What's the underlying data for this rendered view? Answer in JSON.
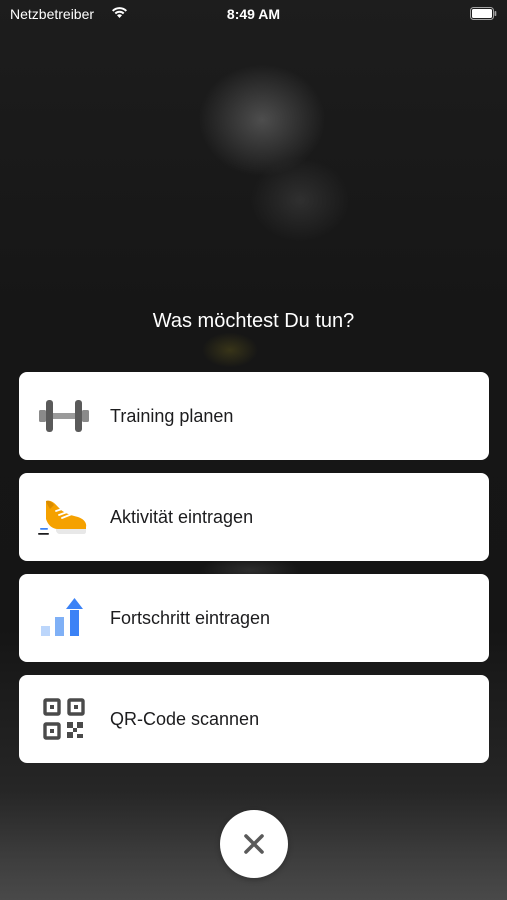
{
  "status_bar": {
    "carrier": "Netzbetreiber",
    "time": "8:49 AM"
  },
  "prompt": "Was möchtest Du tun?",
  "menu": {
    "items": [
      {
        "label": "Training planen",
        "icon": "dumbbell-icon"
      },
      {
        "label": "Aktivität eintragen",
        "icon": "sneaker-icon"
      },
      {
        "label": "Fortschritt eintragen",
        "icon": "progress-chart-icon"
      },
      {
        "label": "QR-Code scannen",
        "icon": "qr-code-icon"
      }
    ]
  },
  "close": {
    "icon": "close-icon"
  },
  "colors": {
    "background": "#161616",
    "card": "#ffffff",
    "sneaker": "#f5a100",
    "chart_blue": "#3b82f6",
    "icon_gray": "#4a4a4a"
  }
}
